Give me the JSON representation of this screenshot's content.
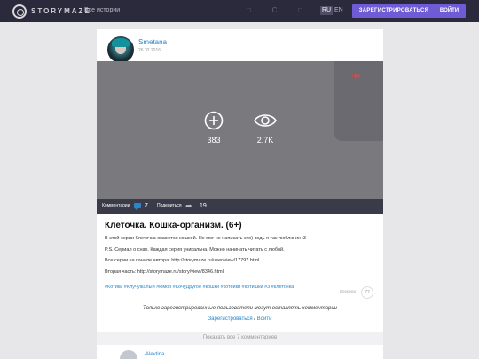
{
  "header": {
    "brand": "STORYMAZE",
    "nav_stories": "Все истории",
    "lang_ru": "RU",
    "lang_en": "EN",
    "register_label": "ЗАРЕГИСТРИРОВАТЬСЯ",
    "login_label": "ВОЙТИ"
  },
  "post": {
    "author": "Smetana",
    "date": "26.02.2016",
    "age_rating": "6+",
    "plus_count": "383",
    "views_count": "2.7K",
    "comments_label": "Комментарии",
    "comments_count": "7",
    "share_label": "Поделиться",
    "share_count": "19",
    "title": "Клеточка. Кошка-организм. (6+)",
    "paragraphs": [
      "В этой серии Клеточка окажется кошкой. Не мог не написать это) ведь я так люблю их :3",
      "P.S. Сериал о снах. Каждая серия уникальна. Можно начинать читать с любой.",
      "Все серии на канале автора: http://storymaze.ru/user/view/17797.html",
      "Вторая часть: http://storymaze.ru/story/view/8346.html"
    ],
    "tags": "#Котики #Клучужалый #юмор #КочуДругое #кошки #котейки #котишки #3 #клеточка",
    "ahead_label": "Впереди",
    "ahead_count": "77"
  },
  "comments": {
    "notice": "Только зарегистрированные пользователи могут оставлять комментарии",
    "register_link": "Зарегистроваться",
    "separator": "/",
    "login_link": "Войти",
    "show_all": "Показать все 7 комментариев",
    "first_author": "Alevtina"
  },
  "colors": {
    "accent": "#6f5bd6",
    "link": "#2a86c9",
    "header_bg": "#2a2a3c"
  }
}
